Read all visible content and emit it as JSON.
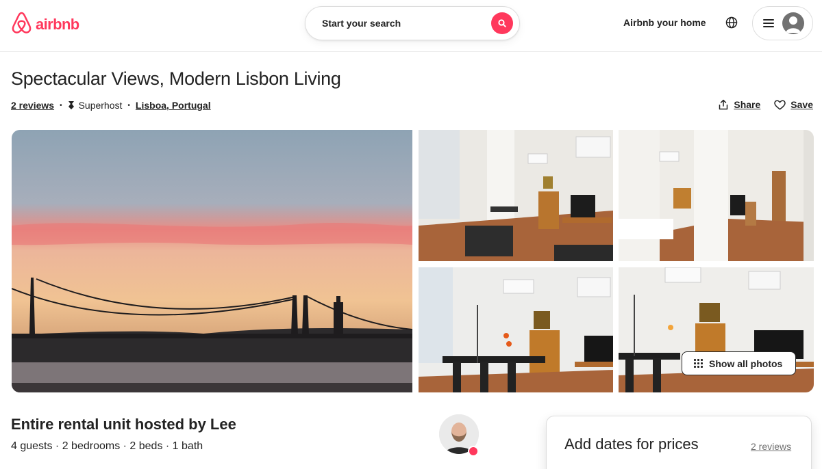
{
  "header": {
    "logo_text": "airbnb",
    "search_label": "Start your search",
    "host_link": "Airbnb your home",
    "icons": [
      "airbnb-logo-icon",
      "search-icon",
      "globe-icon",
      "menu-icon",
      "user-avatar-icon"
    ],
    "brand_color": "#ff385c"
  },
  "listing": {
    "title": "Spectacular Views, Modern Lisbon Living",
    "reviews": "2 reviews",
    "superhost": "Superhost",
    "location": "Lisboa, Portugal",
    "share_label": "Share",
    "save_label": "Save"
  },
  "gallery": {
    "show_all_label": "Show all photos",
    "photos": [
      {
        "subject": "sunset-over-bridge"
      },
      {
        "subject": "living-room"
      },
      {
        "subject": "hallway"
      },
      {
        "subject": "dining-area"
      },
      {
        "subject": "living-room-tv"
      }
    ]
  },
  "overview": {
    "subtitle": "Entire rental unit hosted by Lee",
    "specs": "4 guests · 2 bedrooms · 2 beds · 1 bath"
  },
  "booking": {
    "price_label": "Add dates for prices",
    "reviews": "2 reviews"
  }
}
